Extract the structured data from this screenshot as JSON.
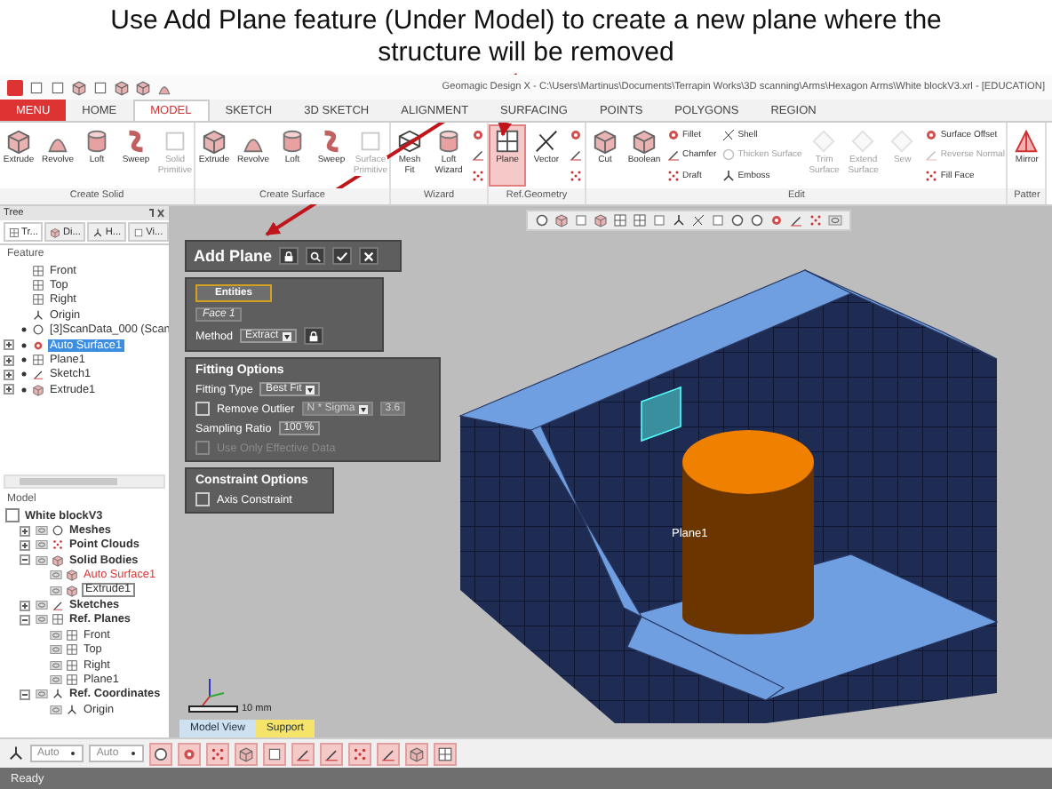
{
  "caption": {
    "text": "Use Add Plane feature (Under Model) to create a new plane where the structure will be removed"
  },
  "window": {
    "title": "Geomagic Design X - C:\\Users\\Martinus\\Documents\\Terrapin Works\\3D scanning\\Arms\\Hexagon Arms\\White blockV3.xrl - [EDUCATION]"
  },
  "tabs": [
    {
      "label": "MENU",
      "kind": "menu",
      "selected": false
    },
    {
      "label": "HOME",
      "kind": "tab",
      "selected": false
    },
    {
      "label": "MODEL",
      "kind": "tab",
      "selected": true
    },
    {
      "label": "SKETCH",
      "kind": "tab",
      "selected": false
    },
    {
      "label": "3D SKETCH",
      "kind": "tab",
      "selected": false
    },
    {
      "label": "ALIGNMENT",
      "kind": "tab",
      "selected": false
    },
    {
      "label": "SURFACING",
      "kind": "tab",
      "selected": false
    },
    {
      "label": "POINTS",
      "kind": "tab",
      "selected": false
    },
    {
      "label": "POLYGONS",
      "kind": "tab",
      "selected": false
    },
    {
      "label": "REGION",
      "kind": "tab",
      "selected": false
    }
  ],
  "ribbon": {
    "groups": [
      {
        "label": "Create Solid",
        "buttons": [
          {
            "label": "Extrude",
            "kind": "large",
            "disabled": false,
            "active": false
          },
          {
            "label": "Revolve",
            "kind": "large",
            "disabled": false,
            "active": false
          },
          {
            "label": "Loft",
            "kind": "large",
            "disabled": false,
            "active": false
          },
          {
            "label": "Sweep",
            "kind": "large",
            "disabled": false,
            "active": false
          },
          {
            "label": "Solid Primitive",
            "kind": "large",
            "disabled": true,
            "active": false
          }
        ]
      },
      {
        "label": "Create Surface",
        "buttons": [
          {
            "label": "Extrude",
            "kind": "large",
            "disabled": false,
            "active": false
          },
          {
            "label": "Revolve",
            "kind": "large",
            "disabled": false,
            "active": false
          },
          {
            "label": "Loft",
            "kind": "large",
            "disabled": false,
            "active": false
          },
          {
            "label": "Sweep",
            "kind": "large",
            "disabled": false,
            "active": false
          },
          {
            "label": "Surface Primitive",
            "kind": "large",
            "disabled": true,
            "active": false
          }
        ]
      },
      {
        "label": "Wizard",
        "buttons": [
          {
            "label": "Mesh Fit",
            "kind": "large",
            "disabled": false,
            "active": false
          },
          {
            "label": "Loft Wizard",
            "kind": "large",
            "disabled": false,
            "active": false
          },
          {
            "kind": "icon",
            "disabled": false,
            "active": false
          },
          {
            "kind": "icon",
            "disabled": false,
            "active": false
          },
          {
            "kind": "icon",
            "disabled": false,
            "active": false
          }
        ]
      },
      {
        "label": "Ref.Geometry",
        "buttons": [
          {
            "label": "Plane",
            "kind": "large",
            "disabled": false,
            "active": true
          },
          {
            "label": "Vector",
            "kind": "large",
            "disabled": false,
            "active": false
          },
          {
            "kind": "icon",
            "disabled": false,
            "active": false
          },
          {
            "kind": "icon",
            "disabled": false,
            "active": false
          },
          {
            "kind": "icon",
            "disabled": false,
            "active": false
          }
        ]
      },
      {
        "label": "Edit",
        "buttons": [
          {
            "label": "Cut",
            "kind": "large",
            "disabled": false,
            "active": false
          },
          {
            "label": "Boolean",
            "kind": "large",
            "disabled": false,
            "active": false
          },
          {
            "label": "Fillet",
            "kind": "small",
            "disabled": false,
            "active": false
          },
          {
            "label": "Chamfer",
            "kind": "small",
            "disabled": false,
            "active": false
          },
          {
            "label": "Draft",
            "kind": "small",
            "disabled": false,
            "active": false
          },
          {
            "label": "Shell",
            "kind": "small",
            "disabled": false,
            "active": false
          },
          {
            "label": "Thicken Surface",
            "kind": "small",
            "disabled": true,
            "active": false
          },
          {
            "label": "Emboss",
            "kind": "small",
            "disabled": false,
            "active": false
          },
          {
            "label": "Trim Surface",
            "kind": "large",
            "disabled": true,
            "active": false
          },
          {
            "label": "Extend Surface",
            "kind": "large",
            "disabled": true,
            "active": false
          },
          {
            "label": "Sew",
            "kind": "large",
            "disabled": true,
            "active": false
          },
          {
            "label": "Surface Offset",
            "kind": "small",
            "disabled": false,
            "active": false
          },
          {
            "label": "Reverse Normal",
            "kind": "small",
            "disabled": true,
            "active": false
          },
          {
            "label": "Fill Face",
            "kind": "small",
            "disabled": false,
            "active": false
          }
        ]
      },
      {
        "label": "Patter",
        "buttons": [
          {
            "label": "Mirror",
            "kind": "large",
            "disabled": false,
            "active": false
          }
        ]
      }
    ]
  },
  "tree_panel": {
    "title": "Tree",
    "tabs": [
      {
        "label": "Tr...",
        "selected": true
      },
      {
        "label": "Di...",
        "selected": false
      },
      {
        "label": "H...",
        "selected": false
      },
      {
        "label": "Vi...",
        "selected": false
      }
    ],
    "feature_header": "Feature",
    "features": [
      {
        "label": "Front",
        "kind": "plane",
        "collapsed": false,
        "shown": false,
        "selected": false
      },
      {
        "label": "Top",
        "kind": "plane",
        "collapsed": false,
        "shown": false,
        "selected": false
      },
      {
        "label": "Right",
        "kind": "plane",
        "collapsed": false,
        "shown": false,
        "selected": false
      },
      {
        "label": "Origin",
        "kind": "origin",
        "collapsed": false,
        "shown": false,
        "selected": false
      },
      {
        "label": "[3]ScanData_000 (Scan",
        "kind": "scan",
        "collapsed": false,
        "shown": true,
        "selected": false
      },
      {
        "label": "Auto Surface1",
        "kind": "surface",
        "collapsed": true,
        "shown": true,
        "selected": true
      },
      {
        "label": "Plane1",
        "kind": "plane",
        "collapsed": true,
        "shown": true,
        "selected": false
      },
      {
        "label": "Sketch1",
        "kind": "sketch",
        "collapsed": true,
        "shown": true,
        "selected": false
      },
      {
        "label": "Extrude1",
        "kind": "extrude",
        "collapsed": true,
        "shown": true,
        "selected": false
      }
    ],
    "model_header": "Model",
    "model_tree": [
      {
        "label": "White blockV3",
        "kind": "root",
        "checked": false,
        "children": [
          {
            "label": "Meshes",
            "kind": "mesh",
            "expanded": false
          },
          {
            "label": "Point Clouds",
            "kind": "points",
            "expanded": false
          },
          {
            "label": "Solid Bodies",
            "kind": "solid",
            "expanded": true,
            "children": [
              {
                "label": "Auto Surface1",
                "kind": "body",
                "error": true,
                "selected": false
              },
              {
                "label": "Extrude1",
                "kind": "body",
                "error": false,
                "selected": true
              }
            ]
          },
          {
            "label": "Sketches",
            "kind": "sketch",
            "expanded": false
          },
          {
            "label": "Ref. Planes",
            "kind": "plane",
            "expanded": true,
            "children": [
              {
                "label": "Front",
                "kind": "plane"
              },
              {
                "label": "Top",
                "kind": "plane"
              },
              {
                "label": "Right",
                "kind": "plane"
              },
              {
                "label": "Plane1",
                "kind": "plane"
              }
            ]
          },
          {
            "label": "Ref. Coordinates",
            "kind": "coord",
            "expanded": true,
            "children": [
              {
                "label": "Origin",
                "kind": "coord"
              }
            ]
          }
        ]
      }
    ]
  },
  "feature_panel": {
    "title": "Add Plane",
    "entities": {
      "button": "Entities",
      "face": "Face 1",
      "method_label": "Method",
      "method": "Extract"
    },
    "fitting": {
      "title": "Fitting Options",
      "type_label": "Fitting Type",
      "type": "Best Fit",
      "remove_outlier": {
        "label": "Remove Outlier",
        "checked": false
      },
      "sigma": "N * Sigma",
      "sigma_value": "3.6",
      "ratio_label": "Sampling Ratio",
      "ratio": "100 %",
      "effective": {
        "label": "Use Only Effective Data",
        "checked": false,
        "disabled": true
      }
    },
    "constraint": {
      "title": "Constraint Options",
      "axis": {
        "label": "Axis Constraint",
        "checked": false
      }
    }
  },
  "viewport": {
    "plane_label": "Plane1",
    "scale": "10 mm",
    "tabs": [
      {
        "label": "Model View",
        "selected": false
      },
      {
        "label": "Support",
        "selected": true
      }
    ]
  },
  "bottom_toolbar": {
    "dropdowns": [
      "Auto",
      "Auto"
    ]
  },
  "status_bar": {
    "text": "Ready"
  }
}
